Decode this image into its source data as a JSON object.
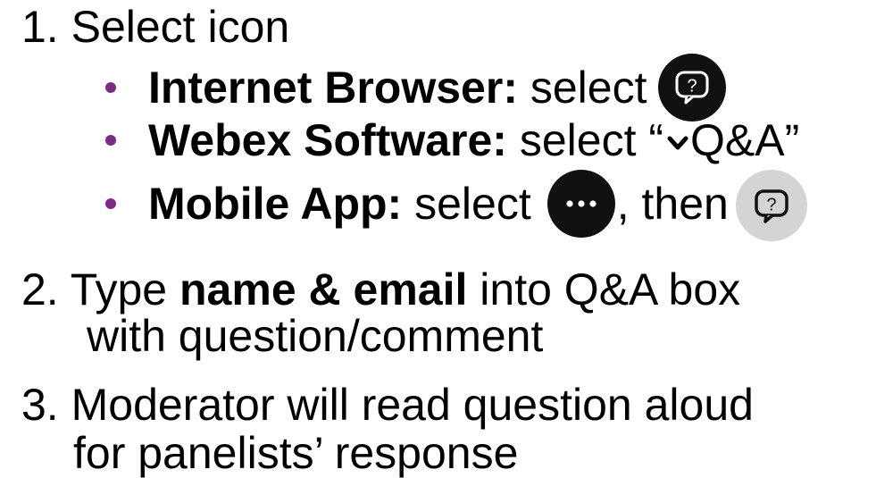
{
  "steps": {
    "step1": {
      "number": "1.",
      "text": "Select icon"
    },
    "bullets": [
      {
        "label": "Internet Browser:",
        "text": "select",
        "icon": "qa-question-icon"
      },
      {
        "label": "Webex Software:",
        "text_before": "select “",
        "text_after": "Q&A”",
        "icon": "chevron-down-icon"
      },
      {
        "label": "Mobile App:",
        "text_before": "select",
        "text_middle": ", then",
        "icons": [
          "more-options-icon",
          "qa-question-icon"
        ]
      }
    ],
    "step2": {
      "number": "2.",
      "text_before": "Type",
      "bold": "name & email",
      "text_after": "into Q&A box",
      "continuation": "with question/comment"
    },
    "step3": {
      "number": "3.",
      "text": "Moderator will read question aloud",
      "continuation": "for panelists’ response"
    }
  },
  "colors": {
    "bullet": "#7a2e83",
    "icon_dark": "#111111",
    "icon_grey": "#d4d4d4",
    "text": "#000000"
  }
}
